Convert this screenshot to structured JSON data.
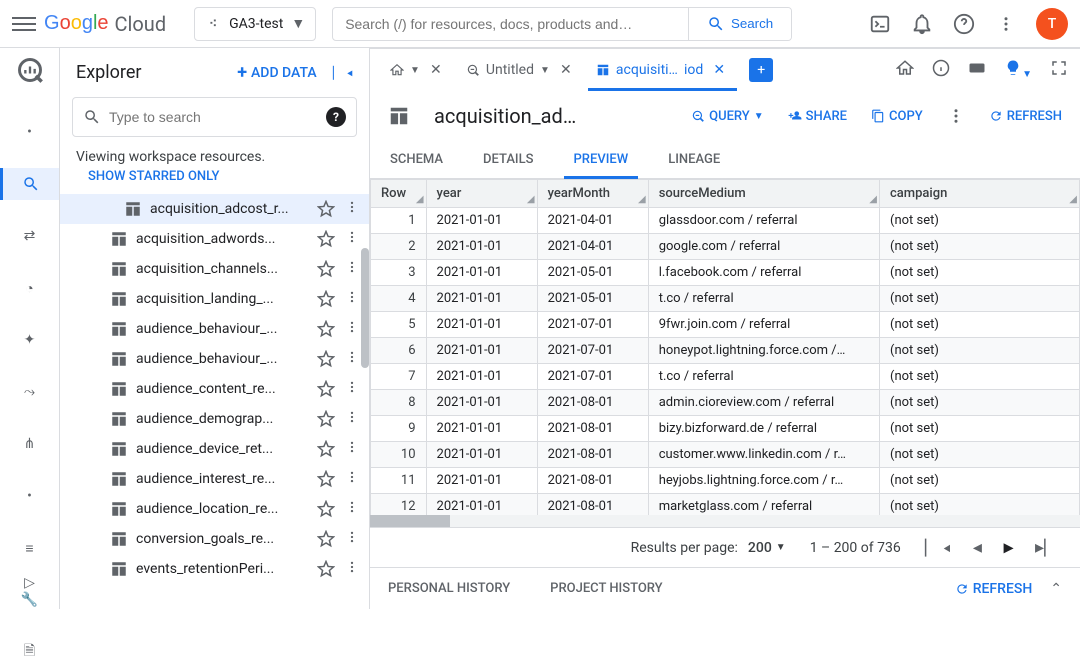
{
  "header": {
    "logo_cloud": "Cloud",
    "project": "GA3-test",
    "search_placeholder": "Search (/) for resources, docs, products and…",
    "search_button": "Search",
    "avatar_initial": "T"
  },
  "explorer": {
    "title": "Explorer",
    "add_data": "ADD DATA",
    "search_placeholder": "Type to search",
    "viewing": "Viewing workspace resources.",
    "starred_link": "SHOW STARRED ONLY",
    "items": [
      {
        "label": "acquisition_adcost_r...",
        "selected": true
      },
      {
        "label": "acquisition_adwords..."
      },
      {
        "label": "acquisition_channels..."
      },
      {
        "label": "acquisition_landing_..."
      },
      {
        "label": "audience_behaviour_..."
      },
      {
        "label": "audience_behaviour_..."
      },
      {
        "label": "audience_content_re..."
      },
      {
        "label": "audience_demograp..."
      },
      {
        "label": "audience_device_ret..."
      },
      {
        "label": "audience_interest_re..."
      },
      {
        "label": "audience_location_re..."
      },
      {
        "label": "conversion_goals_re..."
      },
      {
        "label": "events_retentionPeri..."
      }
    ]
  },
  "tabs": {
    "untitled": "Untitled",
    "active_left": "acquisiti…",
    "active_right": "iod"
  },
  "toolbar": {
    "title": "acquisition_ad…",
    "query": "QUERY",
    "share": "SHARE",
    "copy": "COPY",
    "refresh": "REFRESH"
  },
  "subtabs": {
    "schema": "SCHEMA",
    "details": "DETAILS",
    "preview": "PREVIEW",
    "lineage": "LINEAGE"
  },
  "columns": [
    "Row",
    "year",
    "yearMonth",
    "sourceMedium",
    "campaign"
  ],
  "rows": [
    {
      "n": 1,
      "year": "2021-01-01",
      "ym": "2021-04-01",
      "src": "glassdoor.com / referral",
      "camp": "(not set)"
    },
    {
      "n": 2,
      "year": "2021-01-01",
      "ym": "2021-04-01",
      "src": "google.com / referral",
      "camp": "(not set)"
    },
    {
      "n": 3,
      "year": "2021-01-01",
      "ym": "2021-05-01",
      "src": "l.facebook.com / referral",
      "camp": "(not set)"
    },
    {
      "n": 4,
      "year": "2021-01-01",
      "ym": "2021-05-01",
      "src": "t.co / referral",
      "camp": "(not set)"
    },
    {
      "n": 5,
      "year": "2021-01-01",
      "ym": "2021-07-01",
      "src": "9fwr.join.com / referral",
      "camp": "(not set)"
    },
    {
      "n": 6,
      "year": "2021-01-01",
      "ym": "2021-07-01",
      "src": "honeypot.lightning.force.com /…",
      "camp": "(not set)"
    },
    {
      "n": 7,
      "year": "2021-01-01",
      "ym": "2021-07-01",
      "src": "t.co / referral",
      "camp": "(not set)"
    },
    {
      "n": 8,
      "year": "2021-01-01",
      "ym": "2021-08-01",
      "src": "admin.cioreview.com / referral",
      "camp": "(not set)"
    },
    {
      "n": 9,
      "year": "2021-01-01",
      "ym": "2021-08-01",
      "src": "bizy.bizforward.de / referral",
      "camp": "(not set)"
    },
    {
      "n": 10,
      "year": "2021-01-01",
      "ym": "2021-08-01",
      "src": "customer.www.linkedin.com / r…",
      "camp": "(not set)"
    },
    {
      "n": 11,
      "year": "2021-01-01",
      "ym": "2021-08-01",
      "src": "heyjobs.lightning.force.com / r…",
      "camp": "(not set)"
    },
    {
      "n": 12,
      "year": "2021-01-01",
      "ym": "2021-08-01",
      "src": "marketglass.com / referral",
      "camp": "(not set)"
    }
  ],
  "pager": {
    "label": "Results per page:",
    "perpage": "200",
    "range": "1 – 200 of 736"
  },
  "history": {
    "personal": "PERSONAL HISTORY",
    "project": "PROJECT HISTORY",
    "refresh": "REFRESH"
  }
}
